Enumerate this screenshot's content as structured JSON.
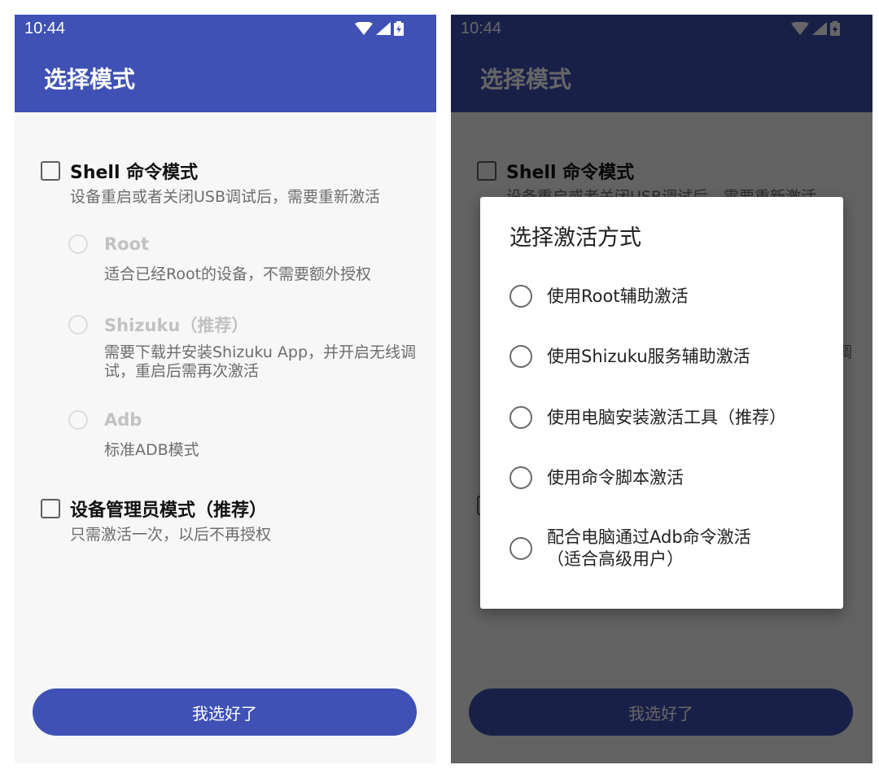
{
  "status": {
    "time": "10:44"
  },
  "appbar": {
    "title": "选择模式"
  },
  "modes": {
    "shell": {
      "label": "Shell 命令模式",
      "desc": "设备重启或者关闭USB调试后，需要重新激活",
      "options": [
        {
          "label": "Root",
          "desc": "适合已经Root的设备，不需要额外授权"
        },
        {
          "label": "Shizuku（推荐）",
          "desc": "需要下载并安装Shizuku App，并开启无线调试，重启后需再次激活"
        },
        {
          "label": "Adb",
          "desc": "标准ADB模式"
        }
      ]
    },
    "device_admin": {
      "label": "设备管理员模式（推荐）",
      "desc": "只需激活一次，以后不再授权"
    }
  },
  "confirm_button": "我选好了",
  "dialog": {
    "title": "选择激活方式",
    "options": [
      "使用Root辅助激活",
      "使用Shizuku服务辅助激活",
      "使用电脑安装激活工具（推荐）",
      "使用命令脚本激活",
      "配合电脑通过Adb命令激活（适合高级用户）"
    ]
  },
  "icons": {
    "wifi": "wifi-icon",
    "signal": "cell-signal-icon",
    "battery": "battery-charging-icon"
  },
  "colors": {
    "primary": "#3f51b5",
    "background": "#f7f7f8"
  }
}
